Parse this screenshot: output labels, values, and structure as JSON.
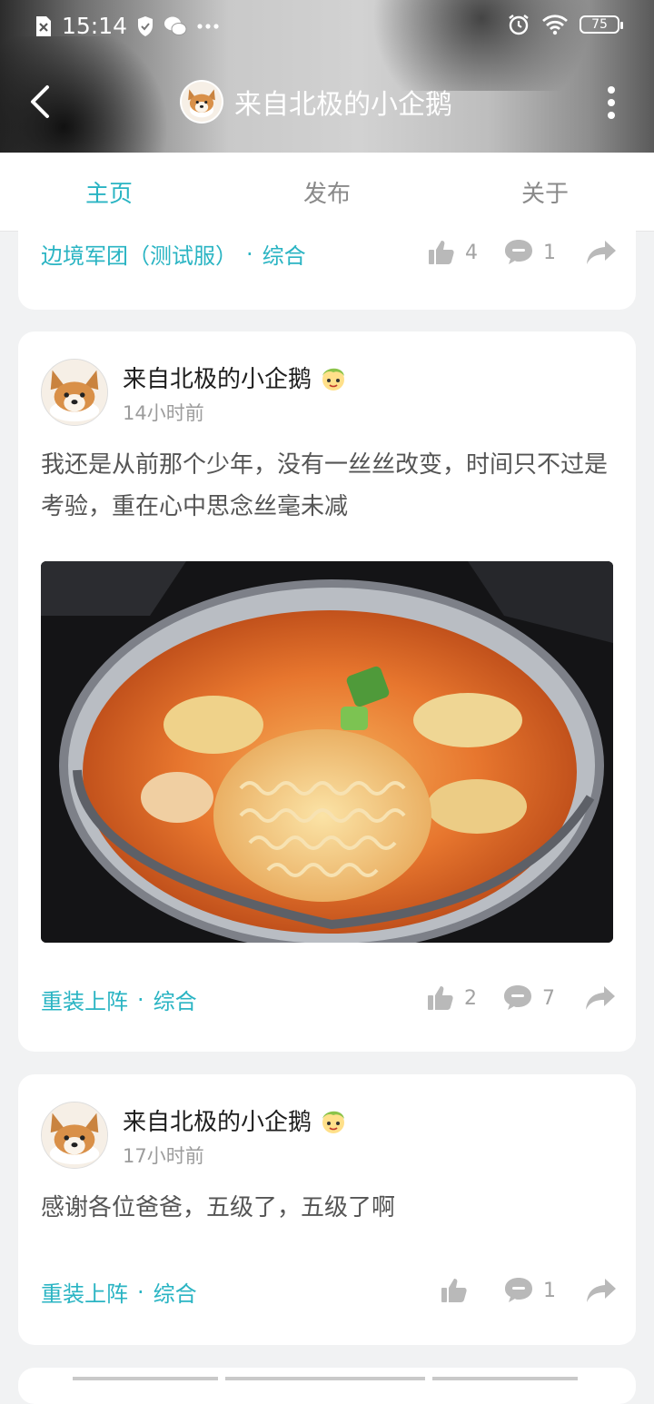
{
  "status_bar": {
    "time": "15:14",
    "battery": "75"
  },
  "header": {
    "title": "来自北极的小企鹅"
  },
  "tabs": [
    {
      "label": "主页",
      "active": true
    },
    {
      "label": "发布",
      "active": false
    },
    {
      "label": "关于",
      "active": false
    }
  ],
  "posts": [
    {
      "tag_group": "边境军团（测试服）",
      "tag_category": "综合",
      "likes": "4",
      "comments": "1"
    },
    {
      "author": "来自北极的小企鹅",
      "time": "14小时前",
      "text": "我还是从前那个少年，没有一丝丝改变，时间只不过是考验，重在心中思念丝毫未减",
      "image": "food-photo",
      "tag_group": "重装上阵",
      "tag_category": "综合",
      "likes": "2",
      "comments": "7"
    },
    {
      "author": "来自北极的小企鹅",
      "time": "17小时前",
      "text": "感谢各位爸爸，五级了，五级了啊",
      "tag_group": "重装上阵",
      "tag_category": "综合",
      "likes": "",
      "comments": "1"
    }
  ],
  "colors": {
    "accent": "#2ab4c3",
    "muted": "#a3a3a3",
    "background": "#f1f2f3"
  }
}
